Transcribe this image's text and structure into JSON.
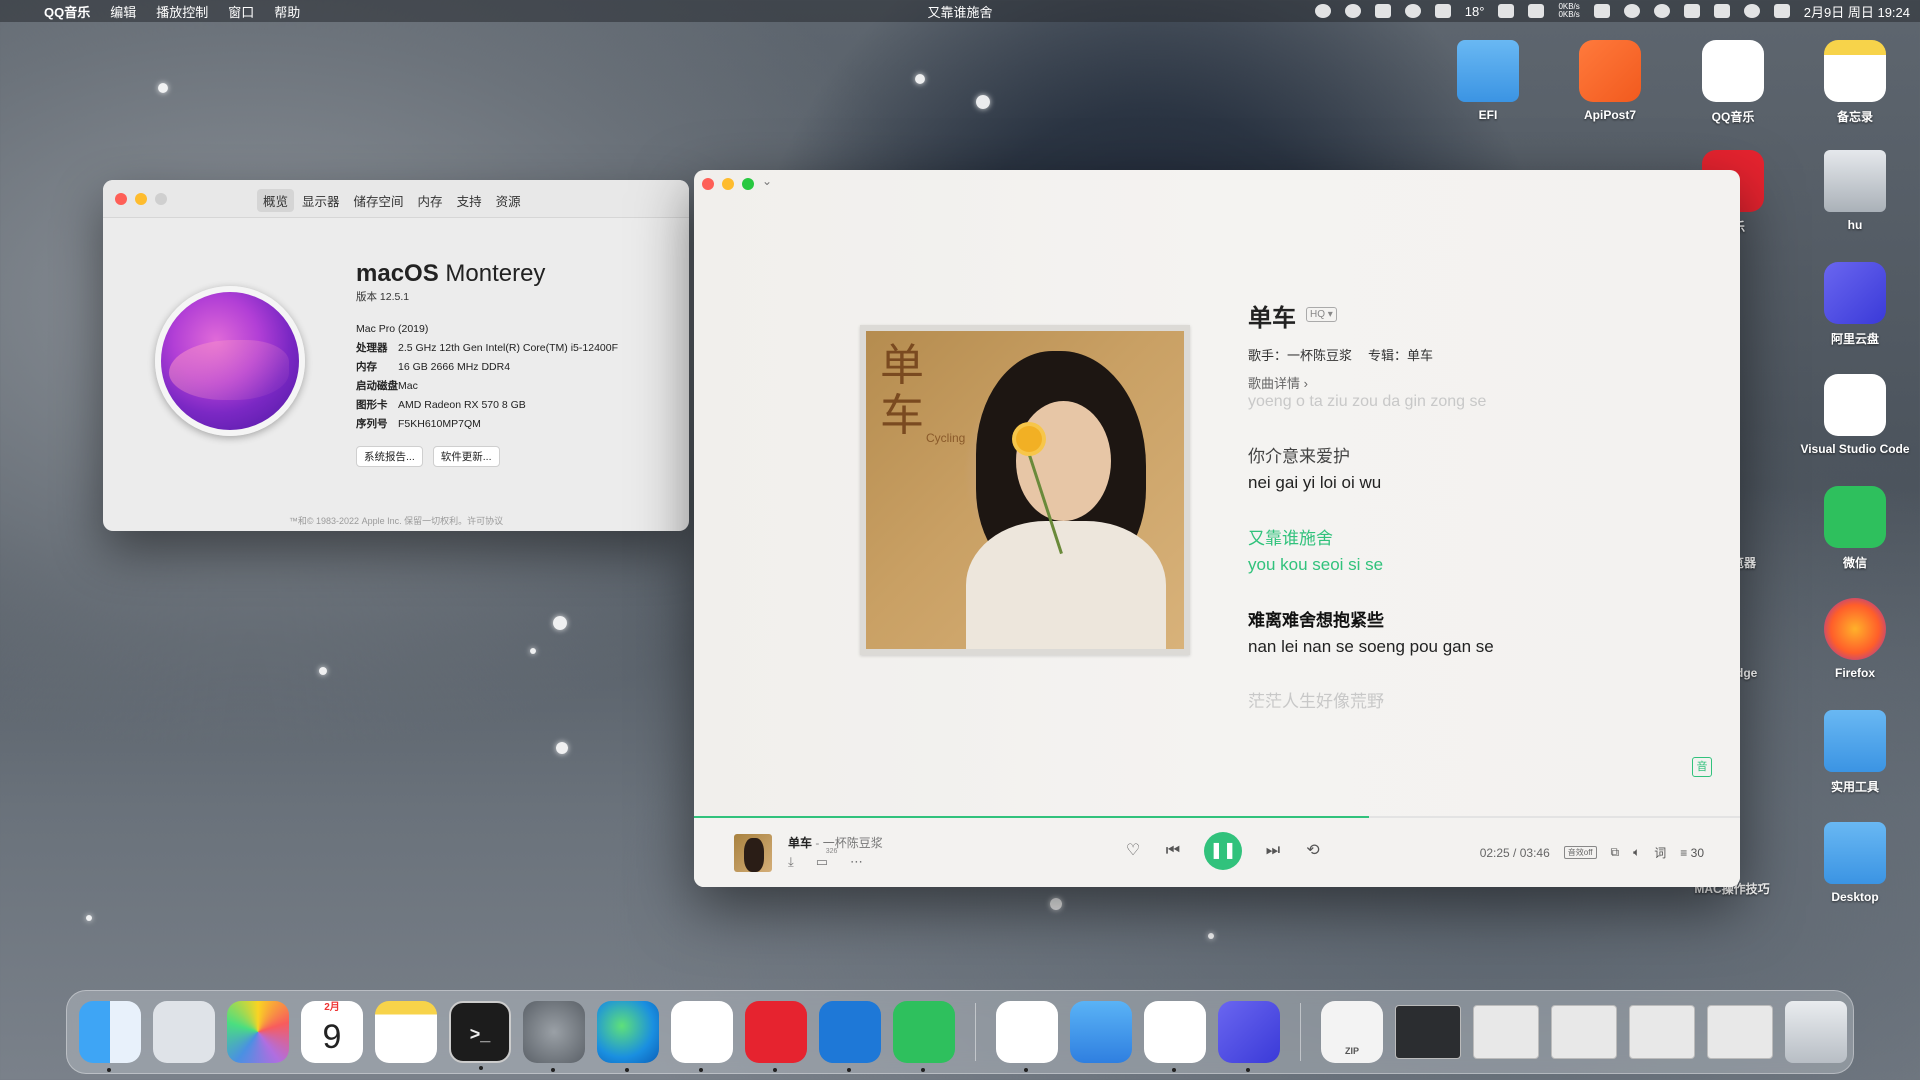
{
  "menubar": {
    "app": "QQ音乐",
    "menus": [
      "编辑",
      "播放控制",
      "窗口",
      "帮助"
    ],
    "now_playing": "又靠谁施舍",
    "net_up": "0KB/s",
    "net_down": "0KB/s",
    "temp": "18°",
    "datetime": "2月9日 周日 19:24"
  },
  "desktop_icons": [
    {
      "label": "EFI"
    },
    {
      "label": "ApiPost7"
    },
    {
      "label": "QQ音乐"
    },
    {
      "label": "备忘录"
    },
    {
      "label": "音乐"
    },
    {
      "label": "hu"
    },
    {
      "label": "阿里云盘"
    },
    {
      "label": "Visual Studio Code"
    },
    {
      "label": "微信"
    },
    {
      "label": "浏览器"
    },
    {
      "label": "Firefox"
    },
    {
      "label": "t Edge"
    },
    {
      "label": "实用工具"
    },
    {
      "label": "Desktop"
    },
    {
      "label": "MAC操作技巧"
    }
  ],
  "about": {
    "tabs": [
      "概览",
      "显示器",
      "储存空间",
      "内存",
      "支持",
      "资源"
    ],
    "os_brand": "macOS",
    "os_name": "Monterey",
    "version": "版本 12.5.1",
    "model": "Mac Pro (2019)",
    "specs": [
      {
        "k": "处理器",
        "v": "2.5 GHz 12th Gen Intel(R) Core(TM) i5-12400F"
      },
      {
        "k": "内存",
        "v": "16 GB 2666 MHz DDR4"
      },
      {
        "k": "启动磁盘",
        "v": "Mac"
      },
      {
        "k": "图形卡",
        "v": "AMD Radeon RX 570 8 GB"
      },
      {
        "k": "序列号",
        "v": "F5KH610MP7QM"
      }
    ],
    "btn_report": "系统报告...",
    "btn_update": "软件更新...",
    "copyright": "™和© 1983-2022 Apple Inc. 保留一切权利。许可协议"
  },
  "player": {
    "cover_text": "单车",
    "cover_sub": "Cycling",
    "title": "单车",
    "quality": "HQ",
    "singer": "歌手：一杯陈豆浆",
    "album": "专辑：单车",
    "details": "歌曲详情 ›",
    "lyrics": [
      {
        "text": "yoeng o ta ziu zou da gin zong se"
      },
      {
        "text": "你介意来爱护"
      },
      {
        "text": "nei gai yi loi oi wu"
      },
      {
        "text": "又靠谁施舍"
      },
      {
        "text": "you kou seoi si se"
      },
      {
        "text": "难离难舍想抱紧些"
      },
      {
        "text": "nan lei nan se soeng pou gan se"
      },
      {
        "text": "茫茫人生好像荒野"
      }
    ],
    "lyric_toggle": "音",
    "progress": 0.645,
    "bar": {
      "song": "单车",
      "dash": " - ",
      "artist": "一杯陈豆浆",
      "comment_count": "326",
      "time": "02:25 / 03:46",
      "effect": "音效off",
      "lyric_btn": "词",
      "playlist_count": "30"
    }
  },
  "dock": {
    "calendar_month": "2月",
    "calendar_day": "9",
    "terminal": ">_",
    "zip": "ZIP"
  }
}
